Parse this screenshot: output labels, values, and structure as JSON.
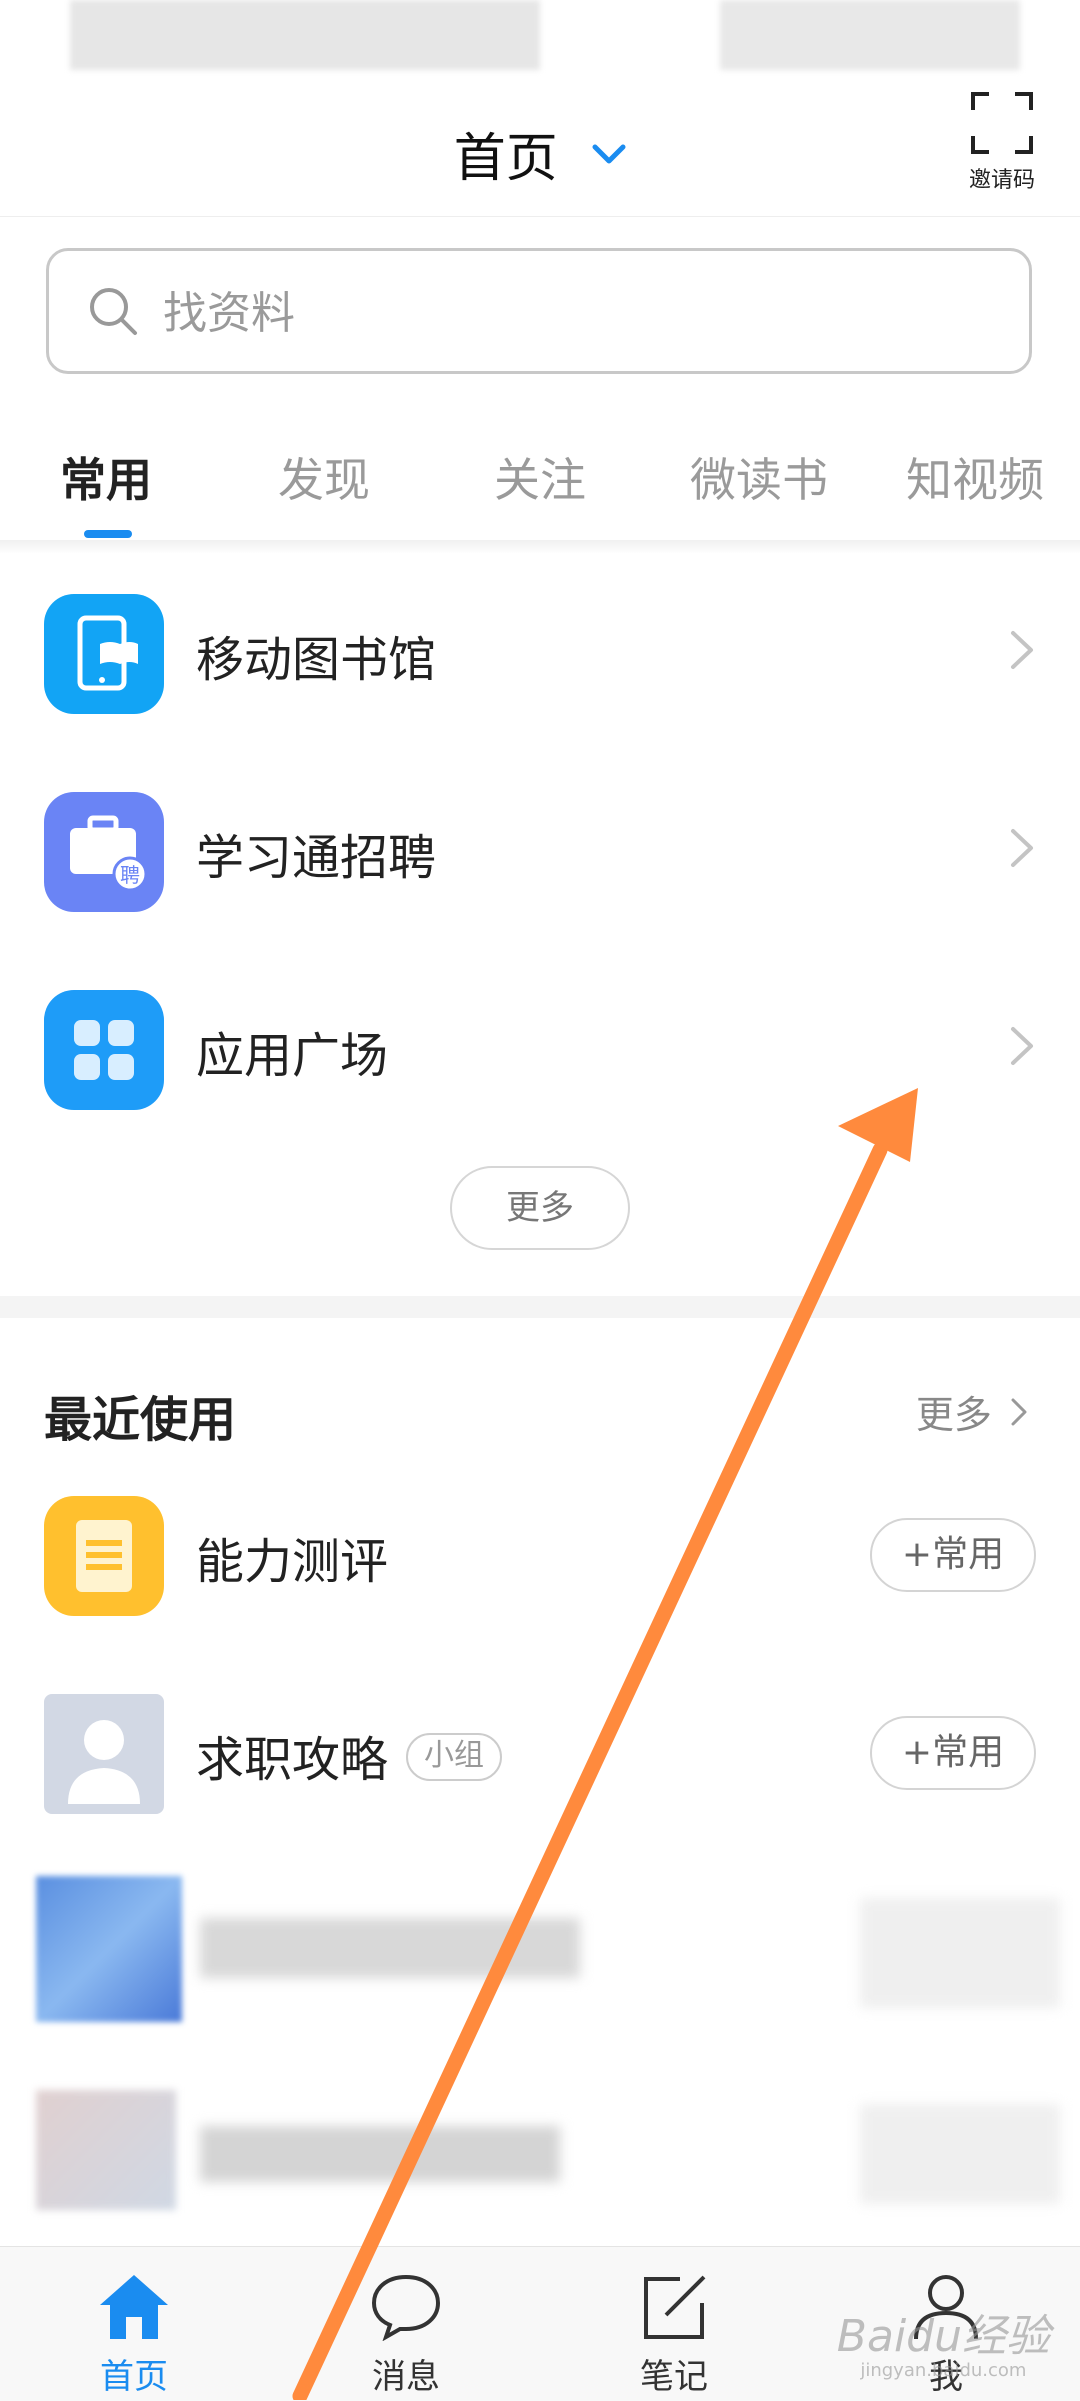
{
  "header": {
    "title": "首页",
    "invite_label": "邀请码"
  },
  "search": {
    "placeholder": "找资料"
  },
  "tabs": [
    {
      "label": "常用",
      "active": true
    },
    {
      "label": "发现",
      "active": false
    },
    {
      "label": "关注",
      "active": false
    },
    {
      "label": "微读书",
      "active": false
    },
    {
      "label": "知视频",
      "active": false
    }
  ],
  "common": {
    "items": [
      {
        "label": "移动图书馆",
        "icon": "mobile-library-icon",
        "color": "#12a4f5"
      },
      {
        "label": "学习通招聘",
        "icon": "recruitment-briefcase-icon",
        "color": "#6a84f5"
      },
      {
        "label": "应用广场",
        "icon": "app-grid-icon",
        "color": "#1e9cf8"
      }
    ],
    "more_label": "更多"
  },
  "recent": {
    "title": "最近使用",
    "more_label": "更多",
    "items": [
      {
        "label": "能力测评",
        "icon": "assessment-doc-icon",
        "color": "#ffc02e",
        "tag": "",
        "action": "+常用"
      },
      {
        "label": "求职攻略",
        "icon": "group-avatar-icon",
        "color": "#d2d8e4",
        "tag": "小组",
        "action": "+常用"
      }
    ]
  },
  "bottom_nav": [
    {
      "label": "首页",
      "icon": "home-icon",
      "active": true
    },
    {
      "label": "消息",
      "icon": "message-icon",
      "active": false
    },
    {
      "label": "笔记",
      "icon": "note-icon",
      "active": false
    },
    {
      "label": "我",
      "icon": "profile-icon",
      "active": false
    }
  ],
  "watermark": {
    "text": "Baidu经验",
    "sub": "jingyan.baidu.com"
  },
  "colors": {
    "accent": "#1a8cf0",
    "annotation_arrow": "#ff8a3d"
  }
}
